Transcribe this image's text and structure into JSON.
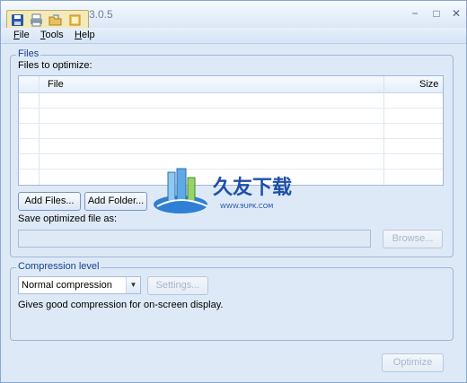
{
  "window": {
    "title": "3.0.5",
    "controls": {
      "minimize": "−",
      "maximize": "□",
      "close": "✕"
    }
  },
  "quick_access": {
    "icons": [
      "save-icon",
      "print-icon",
      "open-icon",
      "folder-icon"
    ]
  },
  "menu": {
    "items": [
      "File",
      "Tools",
      "Help"
    ]
  },
  "files_group": {
    "title": "Files",
    "files_label": "Files to optimize:",
    "columns": [
      "File",
      "Size"
    ],
    "rows": [],
    "add_files_label": "Add Files...",
    "add_folder_label": "Add Folder...",
    "save_label": "Save optimized file as:",
    "save_path_value": "",
    "browse_label": "Browse..."
  },
  "compression_group": {
    "title": "Compression level",
    "selected_level": "Normal compression",
    "settings_label": "Settings...",
    "description": "Gives good compression for on-screen display."
  },
  "footer": {
    "optimize_label": "Optimize"
  },
  "watermark": {
    "text": "久友下载",
    "url": "WWW.9UPK.COM"
  },
  "colors": {
    "accent": "#15428b",
    "background": "#dde9f6",
    "border": "#9fb7d8"
  }
}
